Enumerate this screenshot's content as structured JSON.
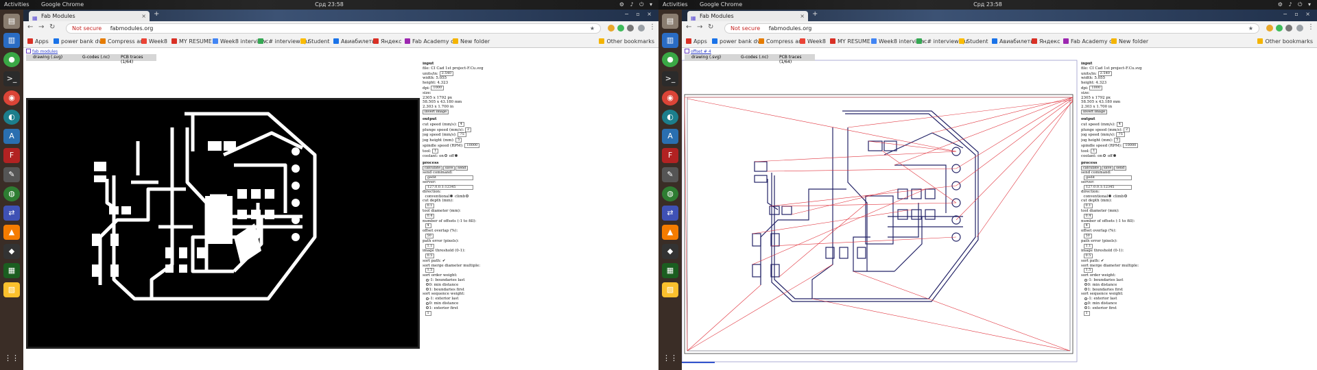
{
  "screens": [
    {
      "topbar": {
        "activities": "Activities",
        "app": "Google Chrome",
        "clock": "Срд 23:58",
        "tray": "⚙ ♪ ⏻ ▾"
      },
      "tab": {
        "title": "Fab Modules",
        "close": "×",
        "new": "+"
      },
      "omnibox": {
        "warning": "Not secure",
        "host": "fabmodules.org"
      },
      "bookmarks": [
        {
          "label": "Apps",
          "color": "#d93025"
        },
        {
          "label": "power bank dvi",
          "color": "#1a73e8"
        },
        {
          "label": "Compress and",
          "color": "#e67c00"
        },
        {
          "label": "Week8",
          "color": "#ea4335"
        },
        {
          "label": "MY RESUME",
          "color": "#d93025"
        },
        {
          "label": "Week8 interview",
          "color": "#4285f4"
        },
        {
          "label": "c# interview qu",
          "color": "#34a853"
        },
        {
          "label": "Student",
          "color": "#fbbc04"
        },
        {
          "label": "Авиабилеты",
          "color": "#1a73e8"
        },
        {
          "label": "Яндекс",
          "color": "#d93025"
        },
        {
          "label": "Fab Academy co",
          "color": "#9c27b0"
        },
        {
          "label": "New folder",
          "color": "#f4b400"
        },
        {
          "label": "Other bookmarks",
          "color": "#f4b400"
        }
      ],
      "crumb": "fab modules",
      "modes": [
        "drawing (.svg)",
        "G-codes (.nc)",
        "PCB traces (1/64)"
      ],
      "view": "image"
    },
    {
      "topbar": {
        "activities": "Activities",
        "app": "Google Chrome",
        "clock": "Срд 23:58",
        "tray": "⚙ ♪ ⏻ ▾"
      },
      "tab": {
        "title": "Fab Modules",
        "close": "×",
        "new": "+"
      },
      "omnibox": {
        "warning": "Not secure",
        "host": "fabmodules.org"
      },
      "bookmarks": [
        {
          "label": "Apps",
          "color": "#d93025"
        },
        {
          "label": "power bank dvi",
          "color": "#1a73e8"
        },
        {
          "label": "Compress and",
          "color": "#e67c00"
        },
        {
          "label": "Week8",
          "color": "#ea4335"
        },
        {
          "label": "MY RESUME",
          "color": "#d93025"
        },
        {
          "label": "Week8 interview",
          "color": "#4285f4"
        },
        {
          "label": "c# interview qu",
          "color": "#34a853"
        },
        {
          "label": "Student",
          "color": "#fbbc04"
        },
        {
          "label": "Авиабилеты",
          "color": "#1a73e8"
        },
        {
          "label": "Яндекс",
          "color": "#d93025"
        },
        {
          "label": "Fab Academy co",
          "color": "#9c27b0"
        },
        {
          "label": "New folder",
          "color": "#f4b400"
        },
        {
          "label": "Other bookmarks",
          "color": "#f4b400"
        }
      ],
      "crumb": "offset # 4",
      "modes": [
        "drawing (.svg)",
        "G-codes (.nc)",
        "PCB traces (1/64)"
      ],
      "view": "toolpath"
    }
  ],
  "side": {
    "input_h": "input",
    "file": "file: CI Cad 1st project-F.Cu.svg",
    "units_l": "units/in:",
    "units_v": "2.540",
    "width": "width: 5.055",
    "height": "height: 4.323",
    "dpi_l": "dpi:",
    "dpi_v": "1000",
    "size_h": "size:",
    "px": "2305 x 1792 px",
    "mm": "58.505 x 43.180 mm",
    "inch": "2.303 x 1.700 in",
    "invert": "invert image",
    "output_h": "output",
    "cut_l": "cut speed (mm/s):",
    "cut_v": "4",
    "plunge_l": "plunge speed (mm/s):",
    "plunge_v": "2",
    "jog_l": "jog speed (mm/s):",
    "jog_v": "75",
    "jogh_l": "jog height (mm):",
    "jogh_v": "5",
    "spindle_l": "spindle speed (RPM):",
    "spindle_v": "10000",
    "tool_l": "tool:",
    "tool_v": "1",
    "coolant_l": "coolant:",
    "on": "on",
    "off": "off",
    "process_h": "process",
    "calculate": "calculate",
    "save": "save",
    "send": "send",
    "sendcmd_l": "send command:",
    "sendcmd_v": "gedit",
    "server_l": "server:",
    "server_v": "127.0.0.1:12345",
    "direction_l": "direction:",
    "conventional": "conventional",
    "climb": "climb",
    "depth_l": "cut depth (mm):",
    "depth_v": "0.1",
    "diam_l": "tool diameter (mm):",
    "diam_v": "0.4",
    "offsets_l": "number of offsets (-1 to fill):",
    "offsets_v": "4",
    "overlap_l": "offset overlap (%):",
    "overlap_v": "50",
    "error_l": "path error (pixels):",
    "error_v": "1.1",
    "thresh_l": "image threshold (0-1):",
    "thresh_v": "0.5",
    "sortpath": "sort path:",
    "merge_l": "sort merge diameter multiple:",
    "merge_v": "1.5",
    "order_l": "sort order weight:",
    "o1": "-1: boundaries last",
    "o2": "0: min distance",
    "o3": "1: boundaries first",
    "seq_l": "sort sequence weight:",
    "s1": "-1: exterior last",
    "s2": "0: min distance",
    "s3": "1: exterior first",
    "seq_v": "1"
  }
}
